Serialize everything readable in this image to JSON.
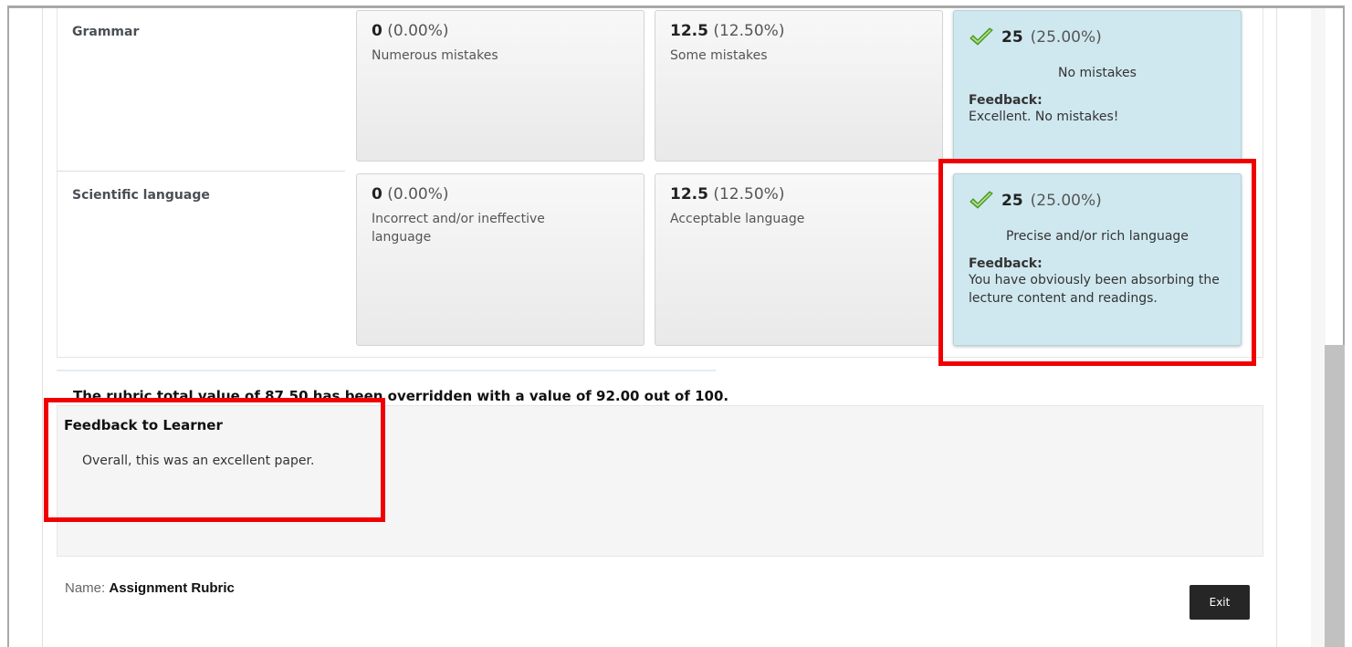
{
  "rubric": {
    "rows": [
      {
        "criterion": "Grammar",
        "levels": [
          {
            "points": "0",
            "percent": "(0.00%)",
            "desc": "Numerous mistakes"
          },
          {
            "points": "12.5",
            "percent": "(12.50%)",
            "desc": "Some mistakes"
          },
          {
            "points": "25",
            "percent": "(25.00%)",
            "desc": "No mistakes",
            "selected": true,
            "feedback_label": "Feedback:",
            "feedback": "Excellent. No mistakes!"
          }
        ]
      },
      {
        "criterion": "Scientific language",
        "levels": [
          {
            "points": "0",
            "percent": "(0.00%)",
            "desc": "Incorrect and/or ineffective language"
          },
          {
            "points": "12.5",
            "percent": "(12.50%)",
            "desc": "Acceptable language"
          },
          {
            "points": "25",
            "percent": "(25.00%)",
            "desc": "Precise and/or rich language",
            "selected": true,
            "feedback_label": "Feedback:",
            "feedback": "You have obviously been absorbing the lecture content and readings."
          }
        ]
      }
    ],
    "selected_icon": "checkmark-icon",
    "selected_color": "#cfe8ef"
  },
  "override_text": "The rubric total value of 87.50 has been overridden with a value of 92.00 out of 100.",
  "learner_feedback": {
    "title": "Feedback to Learner",
    "text": "Overall, this was an excellent paper."
  },
  "footer": {
    "name_label": "Name:",
    "name_value": "Assignment Rubric",
    "exit_label": "Exit"
  },
  "highlight_color": "#f00000"
}
